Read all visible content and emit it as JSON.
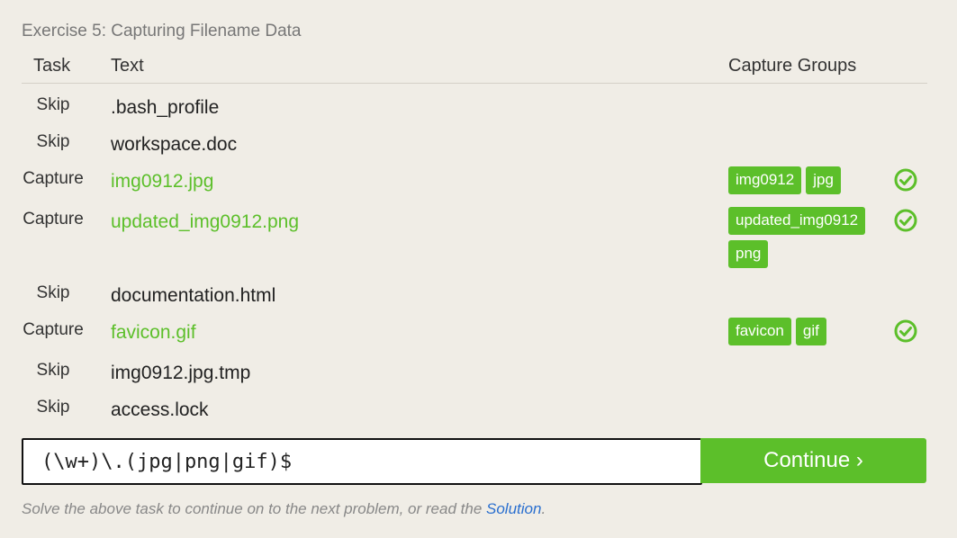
{
  "exercise_title": "Exercise 5: Capturing Filename Data",
  "headers": {
    "task": "Task",
    "text": "Text",
    "capture_groups": "Capture Groups"
  },
  "rows": [
    {
      "task": "Skip",
      "text": ".bash_profile",
      "groups": [],
      "passed": false
    },
    {
      "task": "Skip",
      "text": "workspace.doc",
      "groups": [],
      "passed": false
    },
    {
      "task": "Capture",
      "text": "img0912.jpg",
      "groups": [
        "img0912",
        "jpg"
      ],
      "passed": true
    },
    {
      "task": "Capture",
      "text": "updated_img0912.png",
      "groups": [
        "updated_img0912",
        "png"
      ],
      "passed": true
    },
    {
      "task": "Skip",
      "text": "documentation.html",
      "groups": [],
      "passed": false
    },
    {
      "task": "Capture",
      "text": "favicon.gif",
      "groups": [
        "favicon",
        "gif"
      ],
      "passed": true
    },
    {
      "task": "Skip",
      "text": "img0912.jpg.tmp",
      "groups": [],
      "passed": false
    },
    {
      "task": "Skip",
      "text": "access.lock",
      "groups": [],
      "passed": false
    }
  ],
  "regex_input": {
    "value": "(\\w+)\\.(jpg|png|gif)$"
  },
  "continue_label": "Continue ›",
  "footer": {
    "text_before": "Solve the above task to continue on to the next problem, or read the ",
    "link": "Solution",
    "text_after": "."
  },
  "colors": {
    "accent": "#5cbf2a",
    "link": "#2a6fcf",
    "background": "#f0ede6"
  },
  "icons": {
    "passed": "check-circle-icon"
  }
}
